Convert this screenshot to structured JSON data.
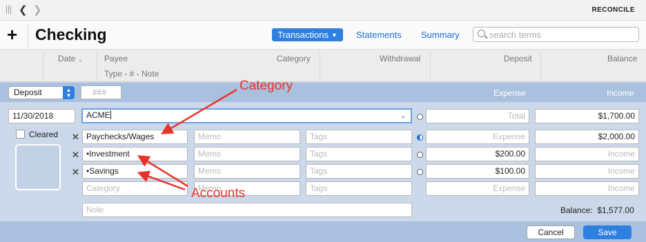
{
  "toolbar": {
    "reconcile_label": "RECONCILE"
  },
  "header": {
    "title": "Checking",
    "add_label": "+",
    "tabs": {
      "transactions": "Transactions",
      "statements": "Statements",
      "summary": "Summary"
    },
    "search_placeholder": "search terms"
  },
  "columns": {
    "date": "Date",
    "payee": "Payee",
    "type_num_note": "Type  -  #  -  Note",
    "category": "Category",
    "withdrawal": "Withdrawal",
    "deposit": "Deposit",
    "balance": "Balance"
  },
  "editor": {
    "type_value": "Deposit",
    "number_placeholder": "###",
    "expense_header": "Expense",
    "income_header": "Income",
    "date": "11/30/2018",
    "payee": "ACME",
    "total_placeholder": "Total",
    "total_income": "$1,700.00",
    "cleared_label": "Cleared",
    "memo_placeholder": "Memo",
    "tags_placeholder": "Tags",
    "expense_placeholder": "Expense",
    "income_placeholder": "Income",
    "category_placeholder": "Category",
    "note_placeholder": "Note",
    "splits": [
      {
        "category": "Paychecks/Wages",
        "expense": "",
        "income": "$2,000.00"
      },
      {
        "category": "•Investment",
        "expense": "$200.00",
        "income": ""
      },
      {
        "category": "•Savings",
        "expense": "$100.00",
        "income": ""
      }
    ],
    "balance_label": "Balance:",
    "balance_value": "$1,577.00"
  },
  "buttons": {
    "cancel": "Cancel",
    "save": "Save"
  },
  "annotations": {
    "category": "Category",
    "accounts": "Accounts"
  },
  "colors": {
    "accent": "#2e7fe0",
    "panel": "#ccd9ea",
    "bar": "#a9c1de",
    "annotation": "#e8332b"
  }
}
